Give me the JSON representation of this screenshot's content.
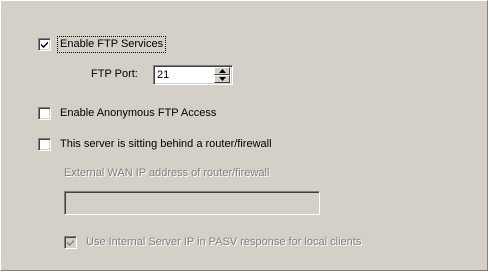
{
  "ftp_settings": {
    "enable_ftp": {
      "label": "Enable FTP Services",
      "checked": true,
      "enabled": true,
      "focused": true
    },
    "ftp_port": {
      "label": "FTP Port:",
      "value": "21"
    },
    "anonymous_access": {
      "label": "Enable Anonymous FTP Access",
      "checked": false,
      "enabled": true
    },
    "behind_router": {
      "label": "This server is sitting behind a router/firewall",
      "checked": false,
      "enabled": true
    },
    "external_wan_ip": {
      "label": "External WAN IP address of router/firewall",
      "value": "",
      "enabled": false
    },
    "use_internal_ip": {
      "label": "Use Internal Server IP in PASV response for local clients",
      "checked": true,
      "enabled": false
    }
  },
  "icons": {
    "check": "check-icon",
    "spin_up": "spin-up-arrow-icon",
    "spin_down": "spin-down-arrow-icon"
  }
}
